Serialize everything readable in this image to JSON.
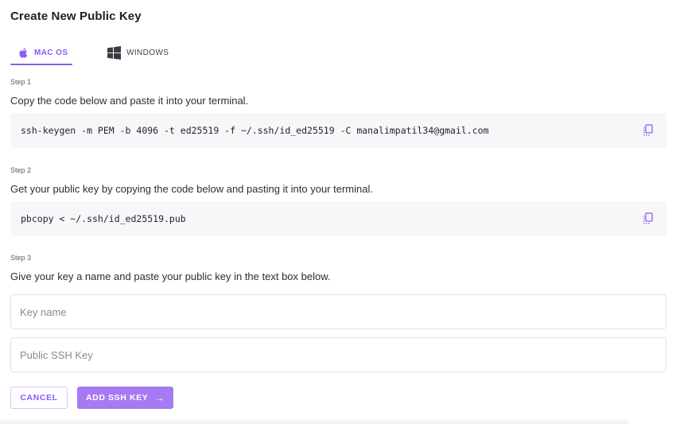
{
  "header": {
    "title": "Create New Public Key"
  },
  "tabs": [
    {
      "label": "MAC OS",
      "icon": "apple-icon",
      "active": true
    },
    {
      "label": "WINDOWS",
      "icon": "windows-icon",
      "active": false
    }
  ],
  "steps": [
    {
      "label": "Step 1",
      "description": "Copy the code below and paste it into your terminal.",
      "code": "ssh-keygen -m PEM -b 4096 -t ed25519 -f ~/.ssh/id_ed25519 -C manalimpatil34@gmail.com"
    },
    {
      "label": "Step 2",
      "description": "Get your public key by copying the code below and pasting it into your terminal.",
      "code": "pbcopy < ~/.ssh/id_ed25519.pub"
    },
    {
      "label": "Step 3",
      "description": "Give your key a name and paste your public key in the text box below."
    }
  ],
  "form": {
    "key_name": {
      "value": "",
      "placeholder": "Key name"
    },
    "public_key": {
      "value": "",
      "placeholder": "Public SSH Key"
    }
  },
  "buttons": {
    "cancel": "CANCEL",
    "add": "ADD SSH KEY",
    "add_icon": "→"
  },
  "colors": {
    "accent": "#8b5cf6",
    "button_fill": "#a57af3",
    "code_bg": "#f7f7fa"
  }
}
